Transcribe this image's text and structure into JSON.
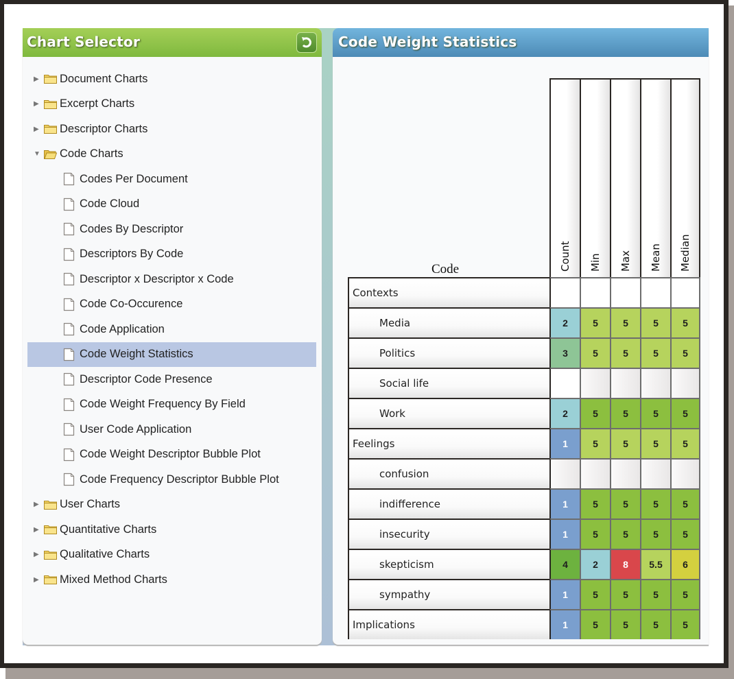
{
  "left_panel": {
    "title": "Chart Selector",
    "refresh_icon": "refresh-icon",
    "tree": [
      {
        "label": "Document Charts",
        "type": "folder",
        "expanded": false
      },
      {
        "label": "Excerpt Charts",
        "type": "folder",
        "expanded": false
      },
      {
        "label": "Descriptor Charts",
        "type": "folder",
        "expanded": false
      },
      {
        "label": "Code Charts",
        "type": "folder",
        "expanded": true
      },
      {
        "label": "Codes Per Document",
        "type": "chart"
      },
      {
        "label": "Code Cloud",
        "type": "chart"
      },
      {
        "label": "Codes By Descriptor",
        "type": "chart"
      },
      {
        "label": "Descriptors By Code",
        "type": "chart"
      },
      {
        "label": "Descriptor x Descriptor x Code",
        "type": "chart"
      },
      {
        "label": "Code Co-Occurence",
        "type": "chart"
      },
      {
        "label": "Code Application",
        "type": "chart"
      },
      {
        "label": "Code Weight Statistics",
        "type": "chart",
        "selected": true
      },
      {
        "label": "Descriptor Code Presence",
        "type": "chart"
      },
      {
        "label": "Code Weight Frequency By Field",
        "type": "chart"
      },
      {
        "label": "User Code Application",
        "type": "chart"
      },
      {
        "label": "Code Weight Descriptor Bubble Plot",
        "type": "chart"
      },
      {
        "label": "Code Frequency Descriptor Bubble Plot",
        "type": "chart"
      },
      {
        "label": "User Charts",
        "type": "folder",
        "expanded": false
      },
      {
        "label": "Quantitative Charts",
        "type": "folder",
        "expanded": false
      },
      {
        "label": "Qualitative Charts",
        "type": "folder",
        "expanded": false
      },
      {
        "label": "Mixed Method Charts",
        "type": "folder",
        "expanded": false
      }
    ]
  },
  "right_panel": {
    "title": "Code Weight Statistics"
  },
  "colors": {
    "left_header": "#8cc34a",
    "right_header": "#5f9fcb",
    "selected_row": "#b9c7e3",
    "teal": "#9ad0d6",
    "sage": "#8ec596",
    "blue": "#7a9fce",
    "green_light": "#b6d35d",
    "green": "#8cbf3f",
    "green_dark": "#6db23f",
    "red": "#d9474b",
    "yellow": "#d4d03f",
    "empty": "#f6f5f5"
  },
  "chart_data": {
    "type": "table",
    "title": "Code Weight Statistics",
    "row_header": "Code",
    "columns": [
      "Count",
      "Min",
      "Max",
      "Mean",
      "Median"
    ],
    "rows": [
      {
        "code": "Contexts",
        "level": 0,
        "values": [
          null,
          null,
          null,
          null,
          null
        ],
        "colors": [
          "white",
          "white",
          "white",
          "white",
          "white"
        ]
      },
      {
        "code": "Media",
        "level": 1,
        "values": [
          "2",
          "5",
          "5",
          "5",
          "5"
        ],
        "colors": [
          "teal",
          "green_light",
          "green_light",
          "green_light",
          "green_light"
        ]
      },
      {
        "code": "Politics",
        "level": 1,
        "values": [
          "3",
          "5",
          "5",
          "5",
          "5"
        ],
        "colors": [
          "sage",
          "green_light",
          "green_light",
          "green_light",
          "green_light"
        ]
      },
      {
        "code": "Social life",
        "level": 1,
        "values": [
          null,
          null,
          null,
          null,
          null
        ],
        "colors": [
          "white",
          "empty",
          "empty",
          "empty",
          "empty"
        ]
      },
      {
        "code": "Work",
        "level": 1,
        "values": [
          "2",
          "5",
          "5",
          "5",
          "5"
        ],
        "colors": [
          "teal",
          "green",
          "green",
          "green",
          "green"
        ]
      },
      {
        "code": "Feelings",
        "level": 0,
        "values": [
          "1",
          "5",
          "5",
          "5",
          "5"
        ],
        "colors": [
          "blue",
          "green_light",
          "green_light",
          "green_light",
          "green_light"
        ]
      },
      {
        "code": "confusion",
        "level": 1,
        "values": [
          null,
          null,
          null,
          null,
          null
        ],
        "colors": [
          "empty",
          "empty",
          "empty",
          "empty",
          "empty"
        ]
      },
      {
        "code": "indifference",
        "level": 1,
        "values": [
          "1",
          "5",
          "5",
          "5",
          "5"
        ],
        "colors": [
          "blue",
          "green",
          "green",
          "green",
          "green"
        ]
      },
      {
        "code": "insecurity",
        "level": 1,
        "values": [
          "1",
          "5",
          "5",
          "5",
          "5"
        ],
        "colors": [
          "blue",
          "green",
          "green",
          "green",
          "green"
        ]
      },
      {
        "code": "skepticism",
        "level": 1,
        "values": [
          "4",
          "2",
          "8",
          "5.5",
          "6"
        ],
        "colors": [
          "green_dark",
          "teal",
          "red",
          "green_light",
          "yellow"
        ]
      },
      {
        "code": "sympathy",
        "level": 1,
        "values": [
          "1",
          "5",
          "5",
          "5",
          "5"
        ],
        "colors": [
          "blue",
          "green",
          "green",
          "green",
          "green"
        ]
      },
      {
        "code": "Implications",
        "level": 0,
        "values": [
          "1",
          "5",
          "5",
          "5",
          "5"
        ],
        "colors": [
          "blue",
          "green",
          "green",
          "green",
          "green"
        ]
      }
    ]
  }
}
